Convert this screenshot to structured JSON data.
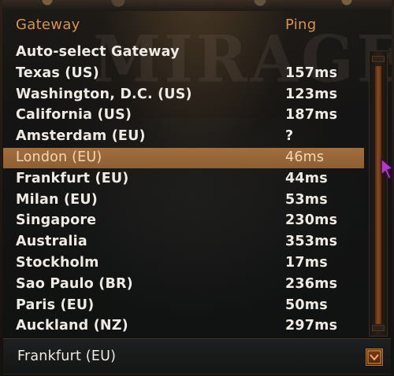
{
  "background": {
    "logo_text": "MIRAGE"
  },
  "header": {
    "gateway_label": "Gateway",
    "ping_label": "Ping"
  },
  "gateways": [
    {
      "name": "Auto-select Gateway",
      "ping": ""
    },
    {
      "name": "Texas (US)",
      "ping": "157ms"
    },
    {
      "name": "Washington, D.C. (US)",
      "ping": "123ms"
    },
    {
      "name": "California (US)",
      "ping": "187ms"
    },
    {
      "name": "Amsterdam (EU)",
      "ping": "?"
    },
    {
      "name": "London (EU)",
      "ping": "46ms",
      "selected": true
    },
    {
      "name": "Frankfurt (EU)",
      "ping": "44ms"
    },
    {
      "name": "Milan (EU)",
      "ping": "53ms"
    },
    {
      "name": "Singapore",
      "ping": "230ms"
    },
    {
      "name": "Australia",
      "ping": "353ms"
    },
    {
      "name": "Stockholm",
      "ping": "17ms"
    },
    {
      "name": "Sao Paulo (BR)",
      "ping": "236ms"
    },
    {
      "name": "Paris (EU)",
      "ping": "50ms"
    },
    {
      "name": "Auckland (NZ)",
      "ping": "297ms"
    }
  ],
  "dropdown": {
    "selected_value": "Frankfurt (EU)",
    "arrow_icon": "chevron-down-icon"
  },
  "colors": {
    "accent": "#d9944a",
    "highlight": "#9a683a",
    "text": "#efeae4"
  }
}
